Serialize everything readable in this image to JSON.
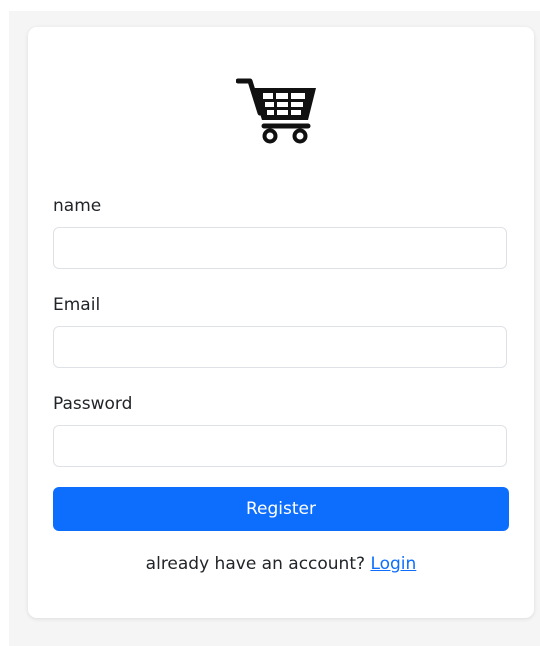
{
  "logo": {
    "icon": "shopping-cart-icon"
  },
  "form": {
    "name_label": "name",
    "name_value": "",
    "email_label": "Email",
    "email_value": "",
    "password_label": "Password",
    "password_value": "",
    "submit_label": "Register"
  },
  "footer": {
    "prompt": "already have an account?",
    "link_label": "Login"
  },
  "colors": {
    "primary": "#0d6efd",
    "background": "#f5f5f5",
    "card": "#ffffff"
  }
}
